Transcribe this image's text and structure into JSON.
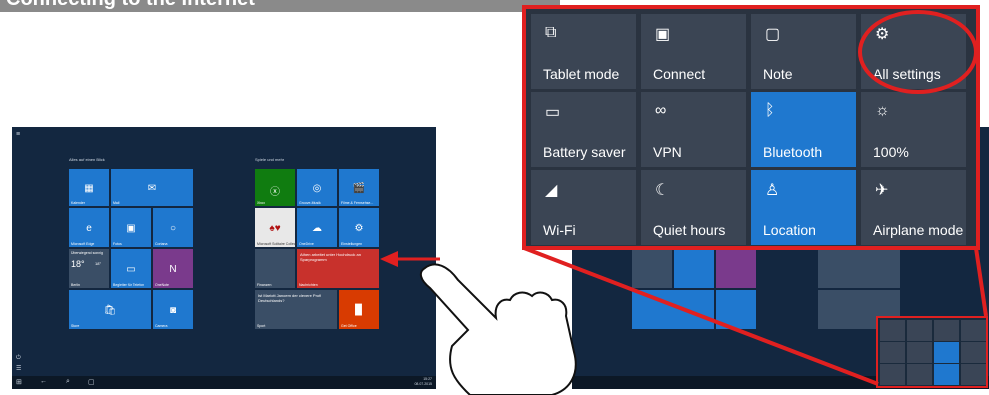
{
  "header": {
    "title": "Connecting to the Internet"
  },
  "start_screen": {
    "group1": "Alles auf einen Blick",
    "group2": "Spiele und mehr",
    "tiles": {
      "calendar": "Kalender",
      "mail": "Mail",
      "edge": "Microsoft Edge",
      "photos": "Fotos",
      "cortana": "Cortana",
      "weather_city": "Berlin",
      "weather_temp": "18°",
      "weather_temp2": "18°",
      "weather_top": "Überwiegend sonnig",
      "phone": "Begleiter für Telefon",
      "onenote": "OneNote",
      "store": "Store",
      "camera": "Camera",
      "xbox": "Xbox",
      "groove": "Groove-Musik",
      "movies": "Filme & Fernsehse...",
      "solitaire": "Microsoft Solitaire Collection",
      "onedrive": "OneDrive",
      "settings": "Einstellungen",
      "finance": "Finanzen",
      "news": "Nachrichten",
      "news_text": "Athen arbeitet unter Hochdruck an Sparprogramm",
      "sport": "Sport",
      "sport_text": "Ist Mariott Janoem der clevere Profi Deutschlands?",
      "office": "Get Office"
    },
    "time": "15:27",
    "date": "08.07.2015"
  },
  "action_center_zoom": {
    "tiles": [
      {
        "label": "Tablet mode",
        "icon": "tablet-icon",
        "on": false
      },
      {
        "label": "Connect",
        "icon": "connect-icon",
        "on": false
      },
      {
        "label": "Note",
        "icon": "note-icon",
        "on": false
      },
      {
        "label": "All settings",
        "icon": "gear-icon",
        "on": false
      },
      {
        "label": "Battery saver",
        "icon": "battery-icon",
        "on": false
      },
      {
        "label": "VPN",
        "icon": "vpn-icon",
        "on": false
      },
      {
        "label": "Bluetooth",
        "icon": "bluetooth-icon",
        "on": true
      },
      {
        "label": "100%",
        "icon": "brightness-icon",
        "on": false
      },
      {
        "label": "Wi-Fi",
        "icon": "wifi-icon",
        "on": false
      },
      {
        "label": "Quiet hours",
        "icon": "moon-icon",
        "on": false
      },
      {
        "label": "Location",
        "icon": "location-icon",
        "on": true
      },
      {
        "label": "Airplane mode",
        "icon": "airplane-icon",
        "on": false
      }
    ]
  },
  "colors": {
    "accent": "#1f78cf",
    "highlight": "#e02020",
    "tile": "#3b4554"
  }
}
